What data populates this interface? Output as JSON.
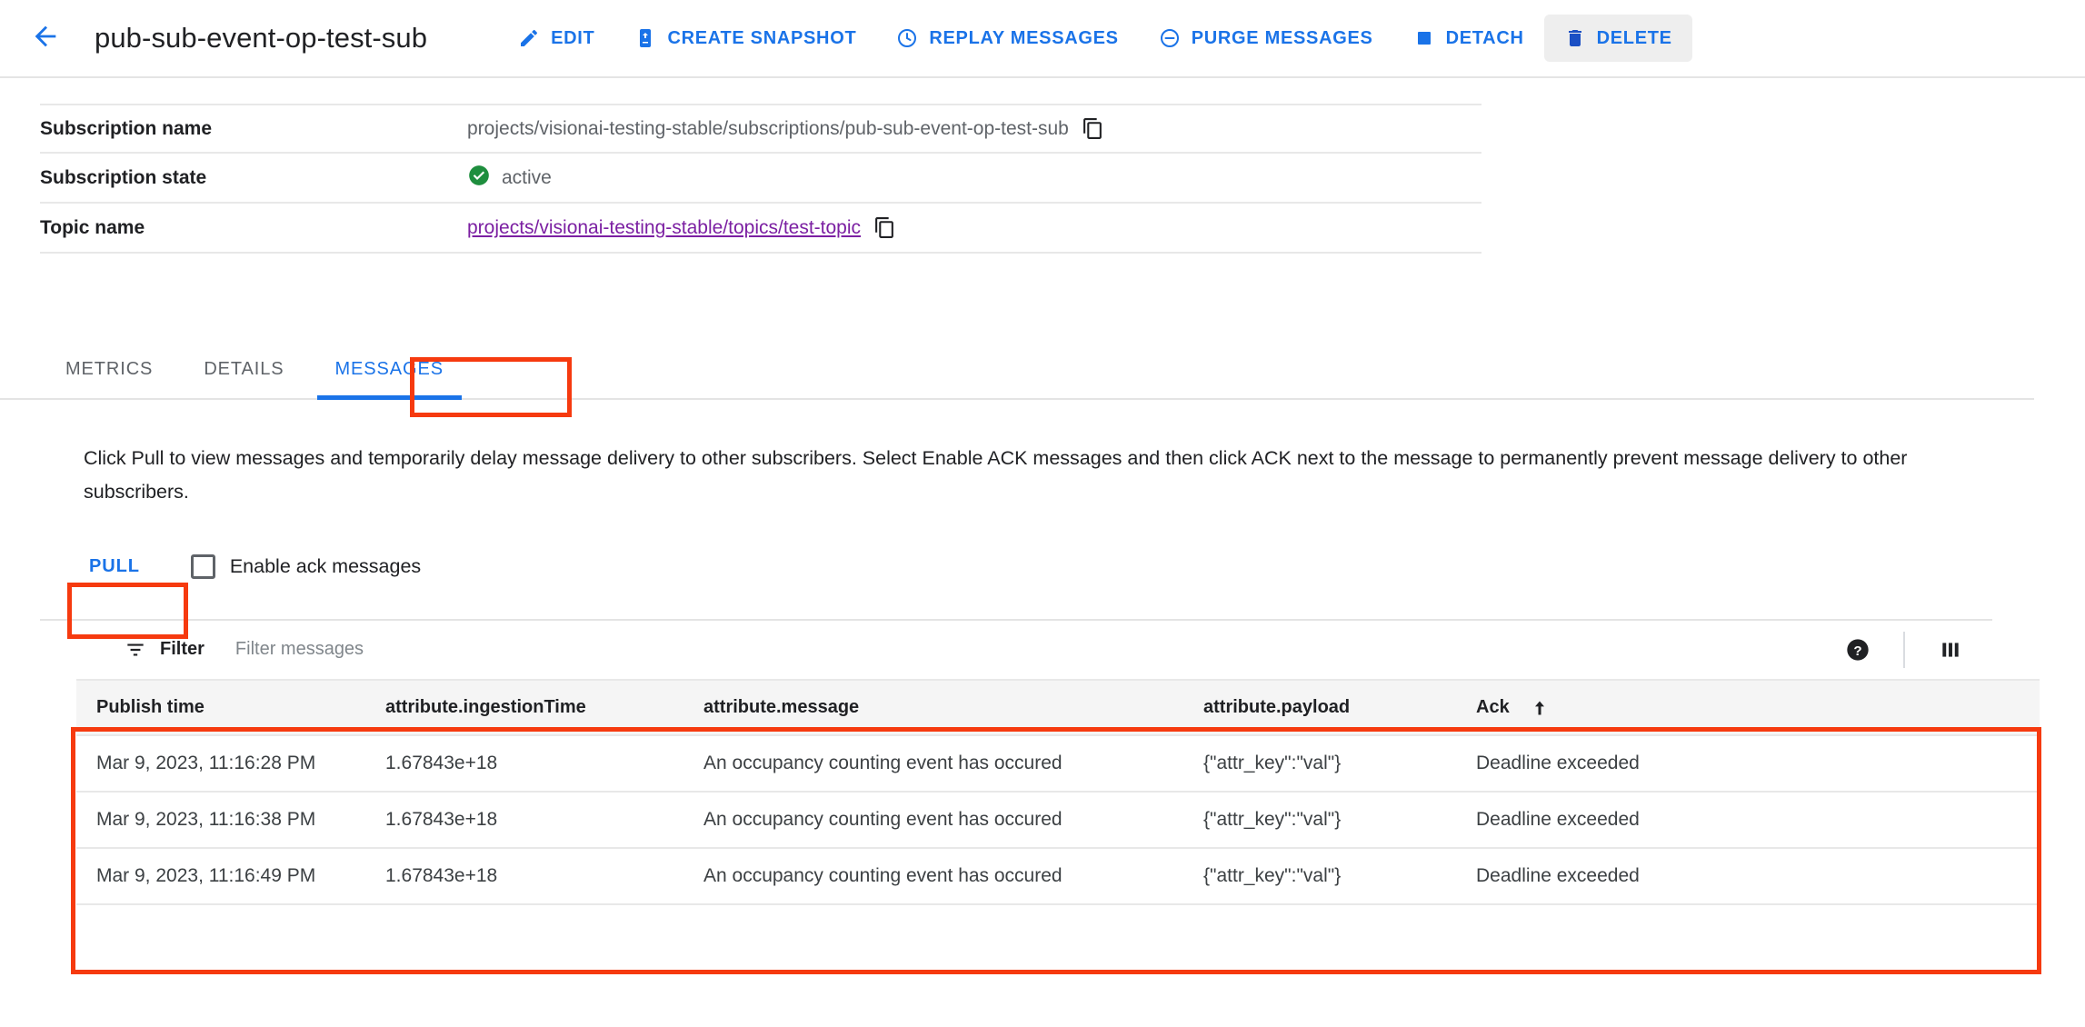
{
  "header": {
    "back_icon": "arrow-left-icon",
    "title": "pub-sub-event-op-test-sub",
    "actions": [
      {
        "label": "EDIT",
        "icon": "pencil-icon",
        "highlighted": false
      },
      {
        "label": "CREATE SNAPSHOT",
        "icon": "snapshot-icon",
        "highlighted": false
      },
      {
        "label": "REPLAY MESSAGES",
        "icon": "clock-icon",
        "highlighted": false
      },
      {
        "label": "PURGE MESSAGES",
        "icon": "minus-circle-icon",
        "highlighted": false
      },
      {
        "label": "DETACH",
        "icon": "square-icon",
        "highlighted": false
      },
      {
        "label": "DELETE",
        "icon": "trash-icon",
        "highlighted": true
      }
    ]
  },
  "info": {
    "rows": [
      {
        "label": "Subscription name",
        "value": "projects/visionai-testing-stable/subscriptions/pub-sub-event-op-test-sub",
        "type": "text-copy"
      },
      {
        "label": "Subscription state",
        "value": "active",
        "type": "status",
        "status_color": "#1e8e3e"
      },
      {
        "label": "Topic name",
        "value": "projects/visionai-testing-stable/topics/test-topic",
        "type": "link-copy",
        "link_color": "#7b1fa2"
      }
    ]
  },
  "tabs": {
    "items": [
      {
        "label": "METRICS",
        "active": false
      },
      {
        "label": "DETAILS",
        "active": false
      },
      {
        "label": "MESSAGES",
        "active": true
      }
    ],
    "accent_color": "#1a73e8"
  },
  "description": "Click Pull to view messages and temporarily delay message delivery to other subscribers. Select Enable ACK messages and then click ACK next to the message to permanently prevent message delivery to other subscribers.",
  "pull": {
    "button_label": "PULL",
    "checkbox_label": "Enable ack messages",
    "checkbox_checked": false
  },
  "filter": {
    "icon": "filter-icon",
    "label": "Filter",
    "placeholder": "Filter messages",
    "help_icon": "help-icon",
    "columns_icon": "columns-icon"
  },
  "table": {
    "columns": [
      {
        "label": "Publish time",
        "sorted": false
      },
      {
        "label": "attribute.ingestionTime",
        "sorted": false
      },
      {
        "label": "attribute.message",
        "sorted": false
      },
      {
        "label": "attribute.payload",
        "sorted": false
      },
      {
        "label": "Ack",
        "sorted": true,
        "sort_dir": "asc"
      }
    ],
    "rows": [
      {
        "publish_time": "Mar 9, 2023, 11:16:28 PM",
        "ingestion_time": "1.67843e+18",
        "message": "An occupancy counting event has occured",
        "payload": "{\"attr_key\":\"val\"}",
        "ack": "Deadline exceeded"
      },
      {
        "publish_time": "Mar 9, 2023, 11:16:38 PM",
        "ingestion_time": "1.67843e+18",
        "message": "An occupancy counting event has occured",
        "payload": "{\"attr_key\":\"val\"}",
        "ack": "Deadline exceeded"
      },
      {
        "publish_time": "Mar 9, 2023, 11:16:49 PM",
        "ingestion_time": "1.67843e+18",
        "message": "An occupancy counting event has occured",
        "payload": "{\"attr_key\":\"val\"}",
        "ack": "Deadline exceeded"
      }
    ]
  },
  "annotations": {
    "highlight_color": "#f63a0f",
    "boxes": [
      "messages-tab",
      "pull-button",
      "messages-table"
    ]
  }
}
